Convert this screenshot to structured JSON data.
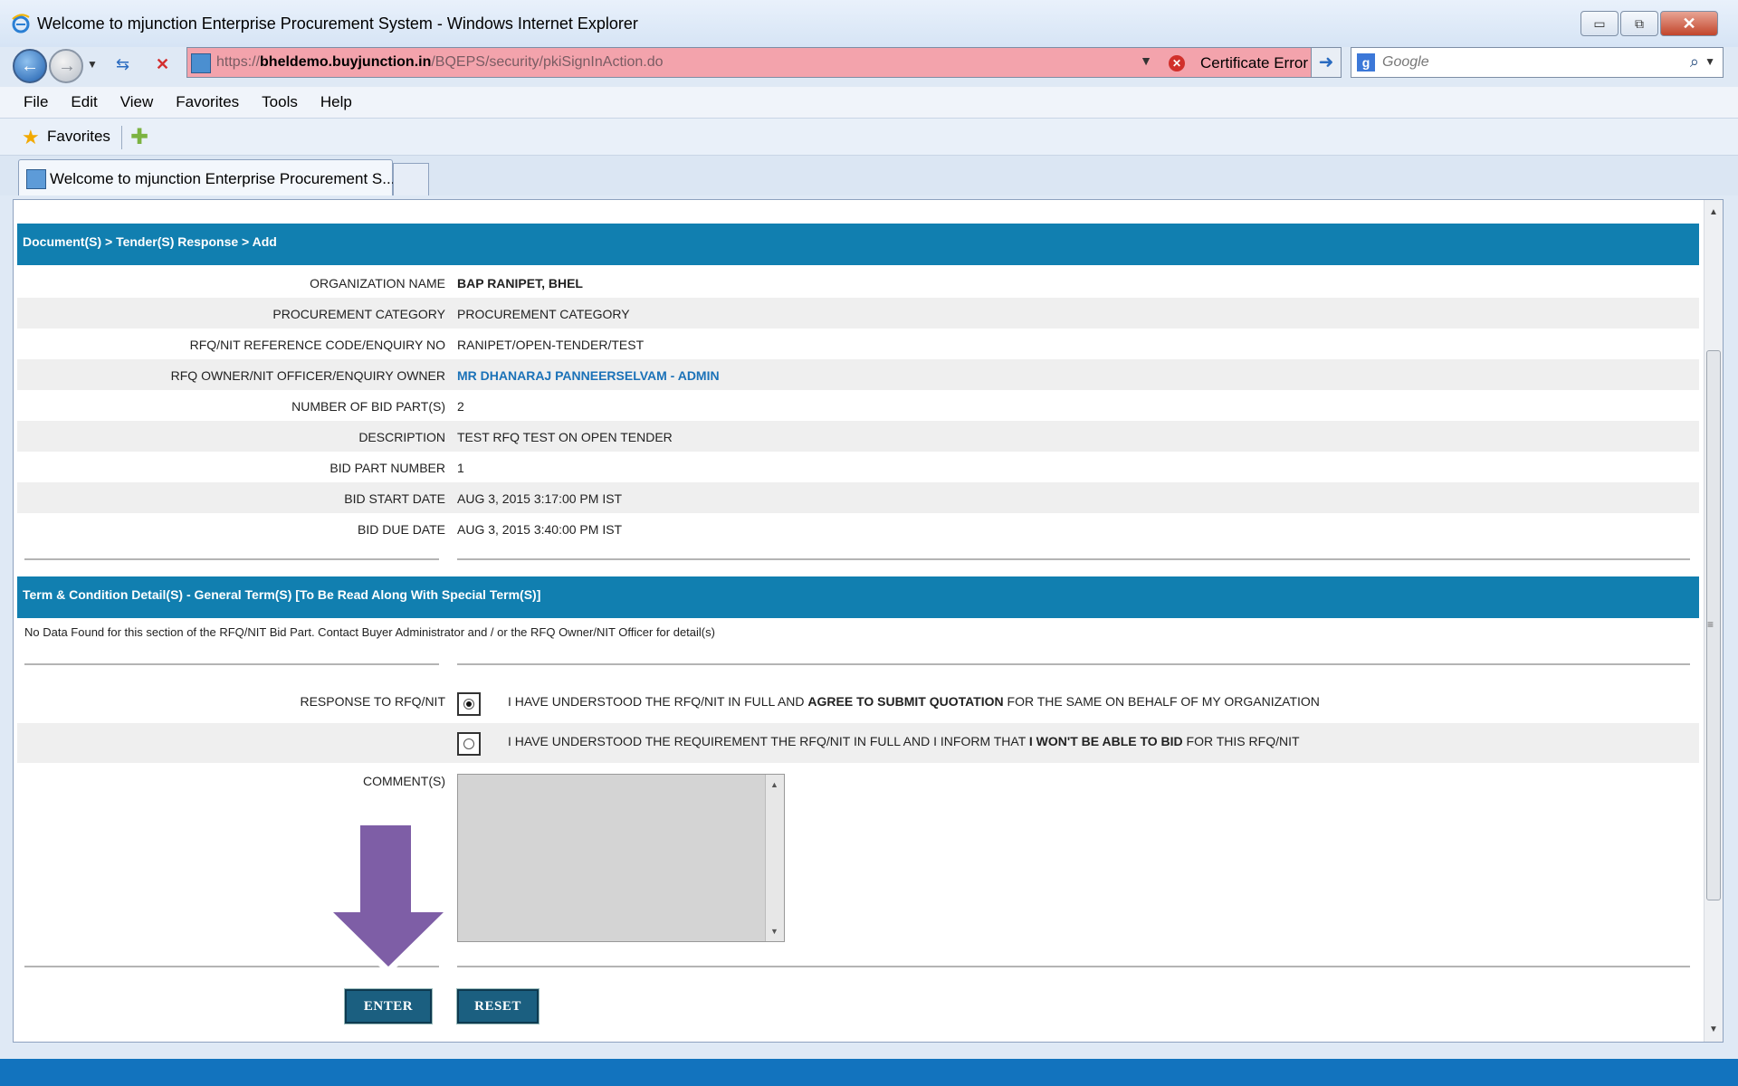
{
  "window": {
    "title": "Welcome to mjunction Enterprise Procurement System - Windows Internet Explorer",
    "controls": {
      "minimize": "▭",
      "maximize": "⧉",
      "close": "✕"
    }
  },
  "address_bar": {
    "url_prefix": "https://",
    "url_host": "bheldemo.buyjunction.in",
    "url_path": "/BQEPS/security/pkiSignInAction.do",
    "certificate_label": "Certificate Error"
  },
  "search": {
    "placeholder": "Google"
  },
  "menu": [
    "File",
    "Edit",
    "View",
    "Favorites",
    "Tools",
    "Help"
  ],
  "favorites": {
    "label": "Favorites"
  },
  "tab": {
    "title": "Welcome to mjunction Enterprise Procurement S..."
  },
  "page": {
    "breadcrumb": "Document(S) > Tender(S) Response > Add",
    "details": [
      {
        "label": "ORGANIZATION NAME",
        "value": "BAP RANIPET, BHEL",
        "style": "bold"
      },
      {
        "label": "PROCUREMENT CATEGORY",
        "value": "PROCUREMENT CATEGORY",
        "style": "plain"
      },
      {
        "label": "RFQ/NIT REFERENCE CODE/ENQUIRY NO",
        "value": "RANIPET/OPEN-TENDER/TEST",
        "style": "plain"
      },
      {
        "label": "RFQ OWNER/NIT OFFICER/ENQUIRY OWNER",
        "value": "MR DHANARAJ PANNEERSELVAM - ADMIN",
        "style": "link"
      },
      {
        "label": "NUMBER OF BID PART(S)",
        "value": "2",
        "style": "plain"
      },
      {
        "label": "DESCRIPTION",
        "value": "TEST RFQ TEST ON OPEN TENDER",
        "style": "plain"
      },
      {
        "label": "BID PART NUMBER",
        "value": "1",
        "style": "plain"
      },
      {
        "label": "BID START DATE",
        "value": "AUG 3, 2015 3:17:00 PM IST",
        "style": "plain"
      },
      {
        "label": "BID DUE DATE",
        "value": "AUG 3, 2015 3:40:00 PM IST",
        "style": "plain"
      }
    ],
    "terms_header": "Term & Condition Detail(S) - General Term(S) [To Be Read Along With Special Term(S)]",
    "no_data": "No Data Found for this section of the RFQ/NIT Bid Part. Contact Buyer Administrator and / or the RFQ Owner/NIT Officer for detail(s)",
    "response_label": "RESPONSE TO RFQ/NIT",
    "option_agree": {
      "pre": "I HAVE UNDERSTOOD THE RFQ/NIT IN FULL AND ",
      "bold": "AGREE TO SUBMIT QUOTATION",
      "post": " FOR THE SAME ON BEHALF OF MY ORGANIZATION",
      "selected": true
    },
    "option_decline": {
      "pre": "I HAVE UNDERSTOOD THE REQUIREMENT THE RFQ/NIT IN FULL AND I INFORM THAT ",
      "bold": "I WON'T BE ABLE TO BID",
      "post": " FOR THIS RFQ/NIT",
      "selected": false
    },
    "comments_label": "COMMENT(S)",
    "comments_value": "",
    "enter_label": "ENTER",
    "reset_label": "RESET"
  },
  "colors": {
    "header_blue": "#117fb0",
    "button_blue": "#1b5f80",
    "link_blue": "#1b72b8",
    "arrow_purple": "#7e5ea6",
    "address_error": "#f3a3ac"
  }
}
